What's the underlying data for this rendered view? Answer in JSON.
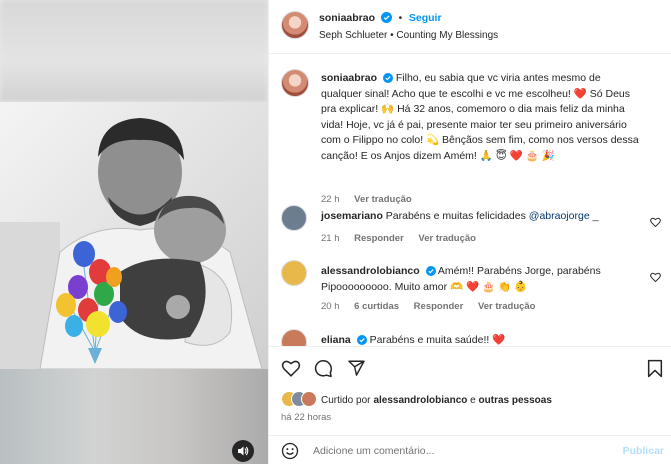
{
  "header": {
    "username": "soniaabrao",
    "follow_label": "Seguir",
    "separator": "•",
    "music": "Seph Schlueter • Counting My Blessings"
  },
  "caption": {
    "username": "soniaabrao",
    "text": "Filho, eu sabia que vc viria antes mesmo de qualquer sinal! Acho que te escolhi e vc me escolheu! ❤️ Só Deus pra explicar! 🙌 Há 32 anos, comemoro o dia mais feliz da minha vida! Hoje, vc já é pai, presente maior ter seu primeiro aniversário com o Filippo no colo! 💫 Bênçãos sem fim, como nos versos dessa canção! E os Anjos dizem Amém! 🙏 😇 ❤️ 🎂 🎉",
    "time": "22 h",
    "translate_label": "Ver tradução"
  },
  "comments": [
    {
      "username": "josemariano",
      "text": "Parabéns e muitas felicidades",
      "mention": "@abraojorge",
      "suffix": " _",
      "time": "21 h",
      "reply_label": "Responder",
      "translate_label": "Ver tradução",
      "avatar_color": "#6b7d8f"
    },
    {
      "username": "alessandrolobianco",
      "text": "Amém!! Parabéns Jorge, parabéns Pipooooooooo. Muito amor 🫶 ❤️ 🎂 👏 👶",
      "time": "20 h",
      "likes": "6 curtidas",
      "reply_label": "Responder",
      "translate_label": "Ver tradução",
      "avatar_color": "#e8b84a"
    },
    {
      "username": "eliana",
      "text": "Parabéns e muita saúde!! ❤️",
      "avatar_color": "#c97a5a"
    }
  ],
  "likes": {
    "prefix": "Curtido por ",
    "user": "alessandrolobianco",
    "middle": " e ",
    "others": "outras pessoas"
  },
  "time_ago": "há 22 horas",
  "add_comment": {
    "placeholder": "Adicione um comentário...",
    "publish_label": "Publicar"
  },
  "colors": {
    "accent": "#0095f6",
    "verified": "#0095f6",
    "like_red": "#ed4956"
  }
}
